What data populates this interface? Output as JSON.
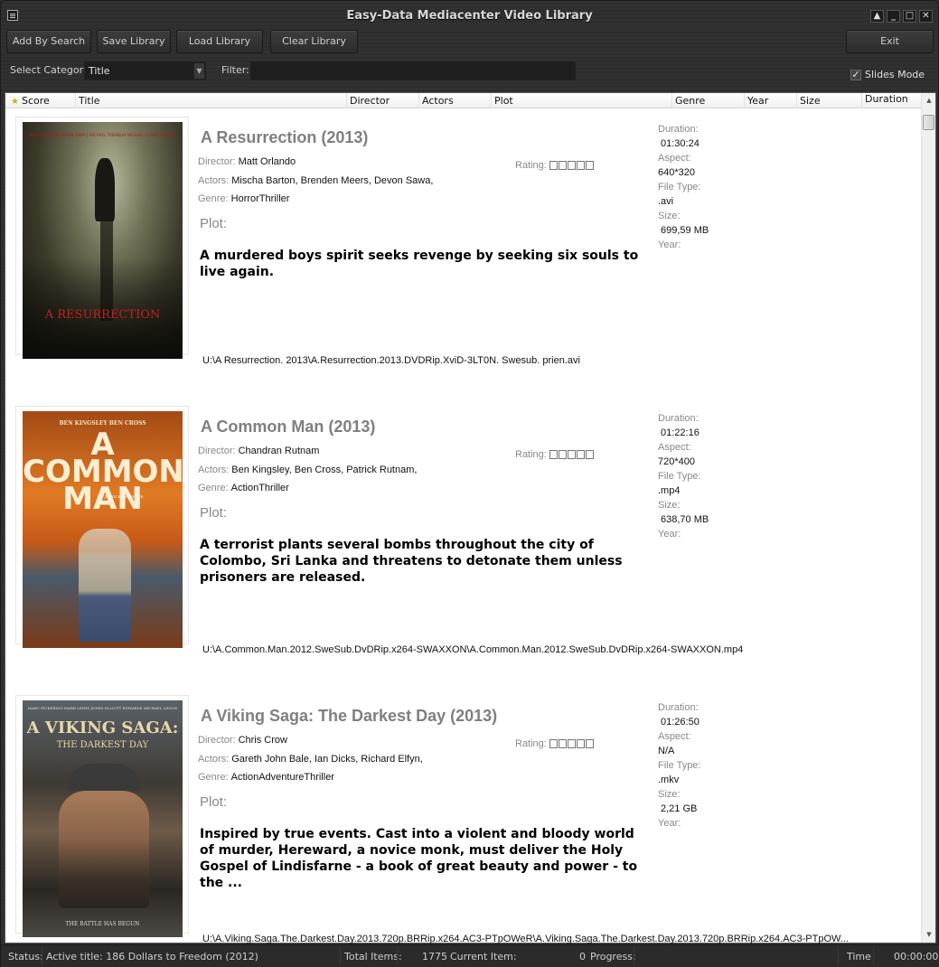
{
  "window": {
    "title": "Easy-Data Mediacenter Video Library",
    "controls": {
      "pin": "▲",
      "minimize": "_",
      "maximize": "□",
      "close": "✕"
    }
  },
  "toolbar": {
    "add_by_search": "Add By Search",
    "save_library": "Save Library",
    "load_library": "Load Library",
    "clear_library": "Clear Library",
    "exit": "Exit"
  },
  "filters": {
    "category_label": "Select Category",
    "category_value": "Title",
    "filter_label": "Filter:",
    "filter_value": "",
    "slides_mode_label": "Slides Mode",
    "slides_mode_checked": true
  },
  "columns": [
    "Score",
    "Title",
    "Director",
    "Actors",
    "Plot",
    "Genre",
    "Year",
    "Size",
    "Duration"
  ],
  "labels": {
    "director": "Director:",
    "actors": "Actors:",
    "genre": "Genre:",
    "plot": "Plot:",
    "rating": "Rating:",
    "duration": "Duration:",
    "aspect": "Aspect:",
    "file_type": "File Type:",
    "size": "Size:",
    "year": "Year:"
  },
  "entries": [
    {
      "title": "A Resurrection (2013)",
      "director": "Matt Orlando",
      "actors": "Mischa Barton, Brenden Meers, Devon Sawa,",
      "genre": "HorrorThriller",
      "plot": "A murdered boys spirit seeks revenge by seeking six souls to live again.",
      "rating": 0,
      "duration": "01:30:24",
      "aspect": "640*320",
      "file_type": ".avi",
      "size": "699,59 MB",
      "year": "",
      "path": "U:\\A Resurrection. 2013\\A.Resurrection.2013.DVDRip.XviD-3LT0N. Swesub. prien.avi",
      "poster_text": "A RESURRECTION",
      "poster_credits": "MISCHA BARTON   DEVON SAWA   J. MICHAEL TREMBLAY   MICHAEL CLARKE DUNCAN"
    },
    {
      "title": "A Common Man (2013)",
      "director": "Chandran Rutnam",
      "actors": "Ben Kingsley, Ben Cross, Patrick Rutnam,",
      "genre": "ActionThriller",
      "plot": "A terrorist plants several bombs throughout the city of Colombo, Sri Lanka and threatens to detonate them unless prisoners are released.",
      "rating": 0,
      "duration": "01:22:16",
      "aspect": "720*400",
      "file_type": ".mp4",
      "size": "638,70 MB",
      "year": "",
      "path": "U:\\A.Common.Man.2012.SweSub.DvDRip.x264-SWAXXON\\A.Common.Man.2012.SweSub.DvDRip.x264-SWAXXON.mp4",
      "poster_text": "A COMMON MAN",
      "poster_credits": "BEN KINGSLEY   BEN CROSS",
      "poster_tagline": "NO JUSTICE. NO PEACE."
    },
    {
      "title": "A Viking Saga: The Darkest Day (2013)",
      "director": "Chris Crow",
      "actors": "Gareth John Bale, Ian Dicks, Richard Elfyn,",
      "genre": "ActionAdventureThriller",
      "plot": "Inspired by true events. Cast into a violent and bloody world of murder, Hereward, a novice monk, must deliver the Holy Gospel of Lindisfarne - a book of great beauty and power - to the ...",
      "rating": 0,
      "duration": "01:26:50",
      "aspect": "N/A",
      "file_type": ".mkv",
      "size": "2,21 GB",
      "year": "",
      "path": "U:\\A.Viking.Saga.The.Darkest.Day.2013.720p.BRRip.x264.AC3-PTpOWeR\\A.Viking.Saga.The.Darkest.Day.2013.720p.BRRip.x264.AC3-PTpOW...",
      "poster_text": "A VIKING SAGA:",
      "poster_subtitle": "THE DARKEST DAY",
      "poster_credits": "MARC PICKERING   MARK LEWIS JONES   ELLIOTT EDWARDS   MICHAEL LEGON",
      "poster_tagline": "THE BATTLE HAS BEGUN"
    }
  ],
  "statusbar": {
    "status_label": "Status:",
    "status_text": "Active title: 186 Dollars to Freedom (2012)",
    "total_items_label": "Total Items:",
    "total_items": "1775",
    "current_item_label": "Current Item:",
    "current_item": "0",
    "progress_label": "Progress:",
    "progress": 0,
    "time_label": "Time",
    "time_value": "00:00:00"
  }
}
